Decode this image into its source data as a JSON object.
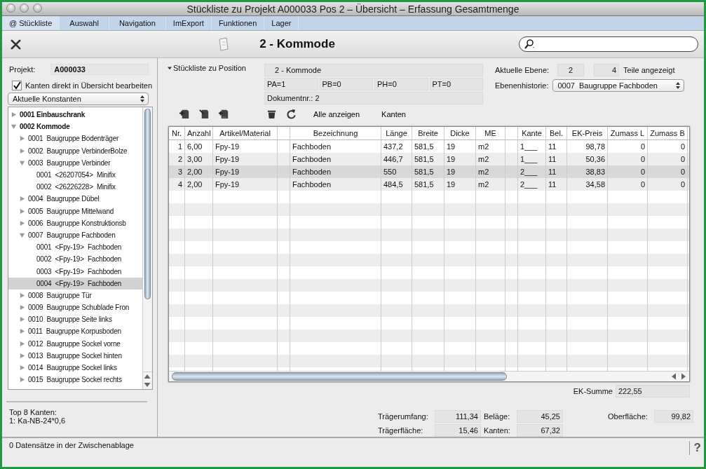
{
  "window": {
    "title": "Stückliste zu Projekt A000033 Pos 2 – Übersicht – Erfassung Gesamtmenge"
  },
  "menu": [
    {
      "label": "@ Stückliste",
      "selected": true
    },
    {
      "label": "Auswahl",
      "selected": false
    },
    {
      "label": "Navigation",
      "selected": false
    },
    {
      "label": "ImExport",
      "selected": false
    },
    {
      "label": "Funktionen",
      "selected": false
    },
    {
      "label": "Lager",
      "selected": false
    }
  ],
  "toolbar": {
    "title": "2 - Kommode"
  },
  "sidebar": {
    "project_label": "Projekt:",
    "project": "A000033",
    "edit_edges": {
      "label": "Kanten direkt in Übersicht bearbeiten",
      "checked": true
    },
    "constants_select": "Aktuelle Konstanten",
    "tree": [
      {
        "label": "0001 Einbauschrank",
        "expanded": false,
        "selected": false
      },
      {
        "label": "0002 Kommode",
        "expanded": true,
        "selected": false,
        "children": [
          {
            "label": "0001  Baugruppe Bodenträger",
            "expanded": false,
            "selected": false
          },
          {
            "label": "0002  Baugruppe VerbinderBolze",
            "expanded": false,
            "selected": false
          },
          {
            "label": "0003  Baugruppe Verbinder",
            "expanded": true,
            "selected": false,
            "children": [
              {
                "label": "0001  <26207054>  Minifix",
                "selected": false
              },
              {
                "label": "0002  <26226228>  Minifix",
                "selected": false
              }
            ]
          },
          {
            "label": "0004  Baugruppe Dübel",
            "expanded": false,
            "selected": false
          },
          {
            "label": "0005  Baugruppe Mittelwand",
            "expanded": false,
            "selected": false
          },
          {
            "label": "0006  Baugruppe Konstruktionsb",
            "expanded": false,
            "selected": false
          },
          {
            "label": "0007  Baugruppe Fachboden",
            "expanded": true,
            "selected": false,
            "children": [
              {
                "label": "0001  <Fpy-19>  Fachboden",
                "selected": false
              },
              {
                "label": "0002  <Fpy-19>  Fachboden",
                "selected": false
              },
              {
                "label": "0003  <Fpy-19>  Fachboden",
                "selected": false
              },
              {
                "label": "0004  <Fpy-19>  Fachboden",
                "selected": true
              }
            ]
          },
          {
            "label": "0008  Baugruppe Tür",
            "expanded": false,
            "selected": false
          },
          {
            "label": "0009  Baugruppe Schublade Fron",
            "expanded": false,
            "selected": false
          },
          {
            "label": "0010  Baugruppe Seite links",
            "expanded": false,
            "selected": false
          },
          {
            "label": "0011  Baugruppe Korpusboden",
            "expanded": false,
            "selected": false
          },
          {
            "label": "0012  Baugruppe Sockel vorne",
            "expanded": false,
            "selected": false
          },
          {
            "label": "0013  Baugruppe Sockel hinten",
            "expanded": false,
            "selected": false
          },
          {
            "label": "0014  Baugruppe Sockel links",
            "expanded": false,
            "selected": false
          },
          {
            "label": "0015  Baugruppe Sockel rechts",
            "expanded": false,
            "selected": false
          }
        ]
      }
    ],
    "top_edges": [
      "Top 8 Kanten:",
      "1: Ka-NB-24*0,6"
    ]
  },
  "position": {
    "toggle_label": "Stückliste zu Position",
    "expanded": true,
    "name": "2 - Kommode",
    "params": [
      "PA=1",
      "PB=0",
      "PH=0",
      "PT=0"
    ],
    "document": "Dokumentnr.: 2",
    "current_level_label": "Aktuelle Ebene:",
    "current_level": "2",
    "parts_count": "4",
    "parts_label": "Teile angezeigt",
    "history_label": "Ebenenhistorie:",
    "history": "0007  Baugruppe Fachboden"
  },
  "buttons": [
    "Alle anzeigen",
    "Kanten"
  ],
  "table": {
    "columns": [
      "Nr.",
      "Anzahl",
      "Artikel/Material",
      "",
      "Bezeichnung",
      "Länge",
      "Breite",
      "Dicke",
      "ME",
      "",
      "Kante",
      "Bel.",
      "EK-Preis",
      "Zumass L",
      "Zumass B"
    ],
    "rows": [
      {
        "selected": false,
        "cells": [
          "1",
          "6,00",
          "Fpy-19",
          "",
          "Fachboden",
          "437,2",
          "581,5",
          "19",
          "m2",
          "",
          "1___",
          "11",
          "98,78",
          "0",
          "0"
        ]
      },
      {
        "selected": false,
        "cells": [
          "2",
          "3,00",
          "Fpy-19",
          "",
          "Fachboden",
          "446,7",
          "581,5",
          "19",
          "m2",
          "",
          "1___",
          "11",
          "50,36",
          "0",
          "0"
        ]
      },
      {
        "selected": true,
        "cells": [
          "3",
          "2,00",
          "Fpy-19",
          "",
          "Fachboden",
          "550",
          "581,5",
          "19",
          "m2",
          "",
          "2___",
          "11",
          "38,83",
          "0",
          "0"
        ]
      },
      {
        "selected": false,
        "cells": [
          "4",
          "2,00",
          "Fpy-19",
          "",
          "Fachboden",
          "484,5",
          "581,5",
          "19",
          "m2",
          "",
          "2___",
          "11",
          "34,58",
          "0",
          "0"
        ]
      }
    ]
  },
  "ek_sum": {
    "label": "EK-Summe",
    "value": "222,55"
  },
  "totals": [
    {
      "label": "Trägerumfang:",
      "value": "111,34"
    },
    {
      "label": "Beläge:",
      "value": "45,25"
    },
    {
      "label": "Oberfläche:",
      "value": "99,82"
    },
    {
      "label": "Trägerfläche:",
      "value": "15,46"
    },
    {
      "label": "Kanten:",
      "value": "67,32"
    }
  ],
  "status_bar": {
    "text": "0 Datensätze in der Zwischenablage",
    "help": "?"
  }
}
